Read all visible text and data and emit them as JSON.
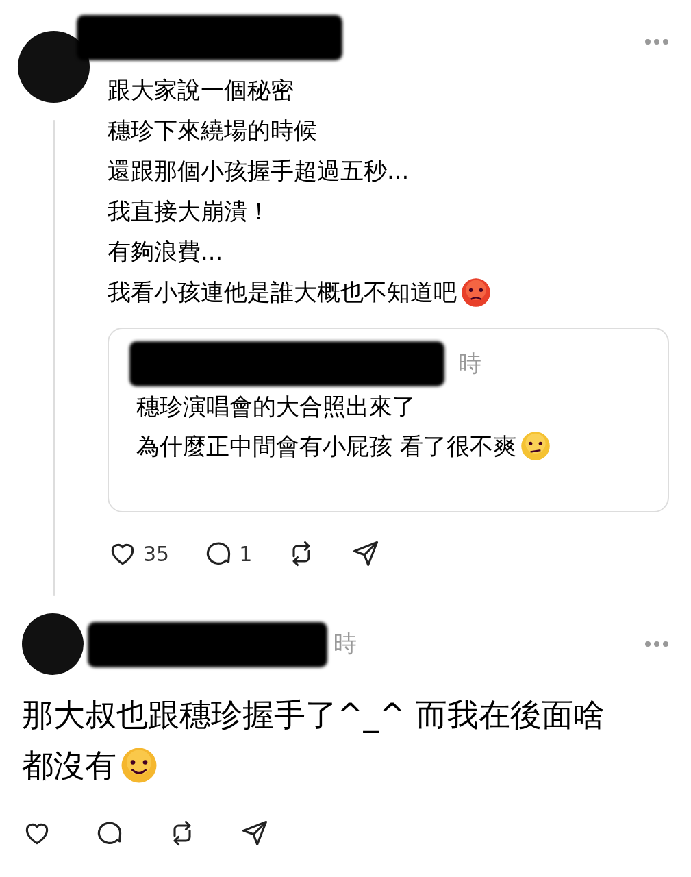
{
  "posts": [
    {
      "thread_line": true,
      "lines": [
        "跟大家說一個秘密",
        "穗珍下來繞場的時候",
        "還跟那個小孩握手超過五秒...",
        "我直接大崩潰！",
        "有夠浪費...",
        "我看小孩連他是誰大概也不知道吧"
      ],
      "quote": {
        "timestamp": "時",
        "lines": [
          "穗珍演唱會的大合照出來了",
          "為什麼正中間會有小屁孩 看了很不爽"
        ]
      },
      "likes": "35",
      "replies": "1"
    },
    {
      "thread_line": false,
      "timestamp": "時",
      "lines": [
        "那大叔也跟穗珍握手了^_^ 而我在後面啥",
        "都沒有"
      ]
    }
  ]
}
